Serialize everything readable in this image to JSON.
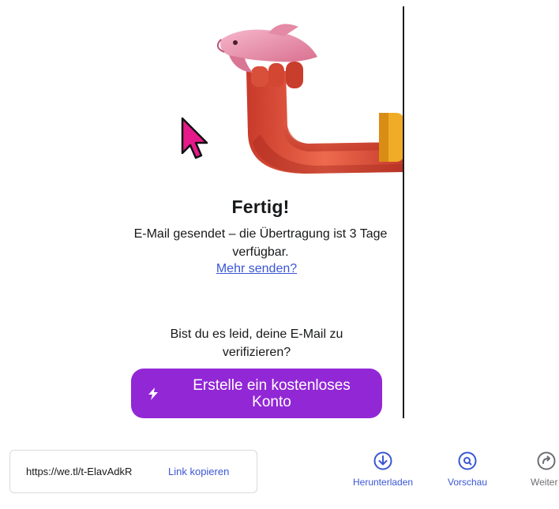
{
  "done": {
    "title": "Fertig!",
    "message": "E-Mail gesendet – die Übertragung ist 3 Tage verfügbar.",
    "send_more_link": "Mehr senden?"
  },
  "signup": {
    "prompt": "Bist du es leid, deine E-Mail zu verifizieren?",
    "cta_label": "Erstelle ein kostenloses Konto",
    "cta_icon": "lightning-bolt-icon"
  },
  "share": {
    "url": "https://we.tl/t-ElavAdkR",
    "copy_label": "Link kopieren"
  },
  "actions": [
    {
      "label": "Herunterladen",
      "icon": "download-icon"
    },
    {
      "label": "Vorschau",
      "icon": "preview-search-icon"
    },
    {
      "label": "Weiter",
      "icon": "forward-icon"
    }
  ],
  "colors": {
    "accent_purple": "#9227d6",
    "link_blue": "#3a56d4",
    "cursor_pink": "#e6198a"
  }
}
